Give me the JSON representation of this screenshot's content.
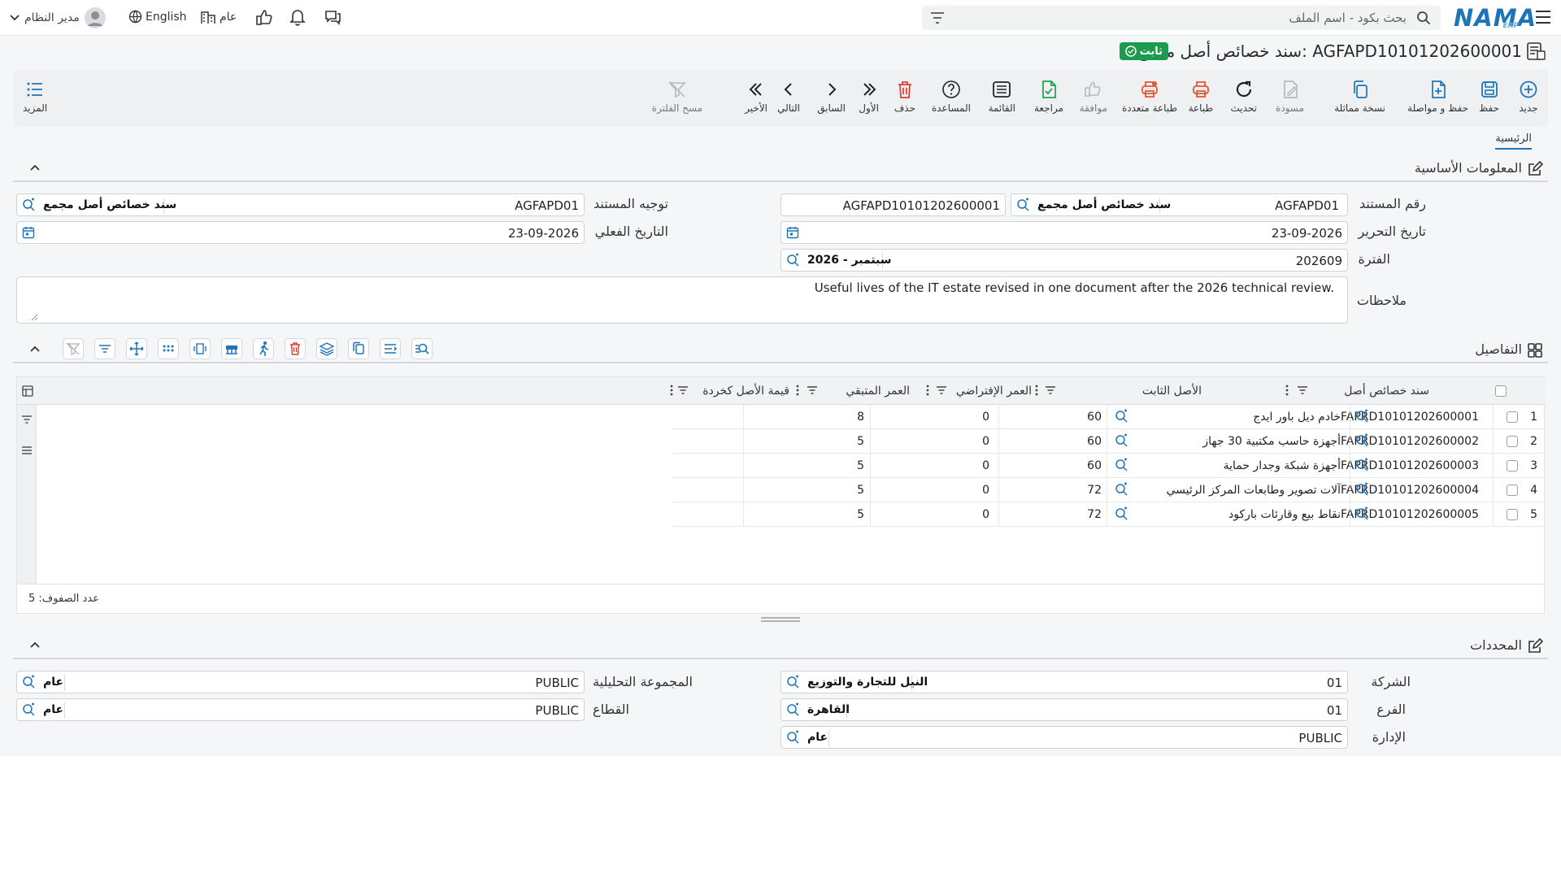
{
  "app": {
    "logo": "NAMA",
    "logo_sub": "ERP"
  },
  "topbar": {
    "search_placeholder": "بحث بكود - اسم الملف",
    "user": "مدير النظام",
    "language": "English",
    "scope": "عام"
  },
  "page": {
    "title": "سند خصائص أصل مجمع: AGFAPD10101202600001",
    "status": "ثابت"
  },
  "toolbar": {
    "new": "جديد",
    "save": "حفظ",
    "save_continue": "حفظ و مواصلة",
    "copy": "نسخة مماثلة",
    "draft": "مسودة",
    "refresh": "تحديث",
    "print": "طباعة",
    "multi_print": "طباعة متعددة",
    "approve": "موافقة",
    "review": "مراجعة",
    "list": "القائمة",
    "help": "المساعدة",
    "delete": "حذف",
    "first": "الأول",
    "previous": "السابق",
    "next": "التالي",
    "last": "الأخير",
    "clear_filter": "مسح الفلترة",
    "more": "المزيد"
  },
  "tabs": {
    "main": "الرئيسية"
  },
  "basic": {
    "section_title": "المعلومات الأساسية",
    "doc_number_label": "رقم المستند",
    "doc_type_code": "AGFAPD01",
    "doc_type_name": "سند خصائص أصل مجمع",
    "doc_number": "AGFAPD10101202600001",
    "direction_label": "توجيه المستند",
    "direction_code": "AGFAPD01",
    "direction_name": "سند خصائص أصل مجمع",
    "edit_date_label": "تاريخ التحرير",
    "edit_date": "23-09-2026",
    "actual_date_label": "التاريخ الفعلي",
    "actual_date": "23-09-2026",
    "period_label": "الفترة",
    "period_code": "202609",
    "period_name": "2026 - سبتمبر",
    "notes_label": "ملاحظات",
    "notes": "Useful lives of the IT estate revised in one document after the 2026 technical review."
  },
  "details": {
    "section_title": "التفاصيل",
    "columns": {
      "doc": "سند خصائص أصل",
      "asset": "الأصل الثابت",
      "default_life": "العمر الإفتراضي",
      "remaining_life": "العمر المتبقي",
      "scrap_value": "قيمة الأصل كخردة"
    },
    "rows": [
      {
        "n": "1",
        "doc": "FAPRD10101202600001",
        "asset": "خادم ديل باور ايدج",
        "default_life": "60",
        "remaining_life": "0",
        "scrap_value": "8"
      },
      {
        "n": "2",
        "doc": "FAPRD10101202600002",
        "asset": "أجهزة حاسب مكتبية 30 جهاز",
        "default_life": "60",
        "remaining_life": "0",
        "scrap_value": "5"
      },
      {
        "n": "3",
        "doc": "FAPRD10101202600003",
        "asset": "أجهزة شبكة وجدار حماية",
        "default_life": "60",
        "remaining_life": "0",
        "scrap_value": "5"
      },
      {
        "n": "4",
        "doc": "FAPRD10101202600004",
        "asset": "آلات تصوير وطابعات المركز الرئيسي",
        "default_life": "72",
        "remaining_life": "0",
        "scrap_value": "5"
      },
      {
        "n": "5",
        "doc": "FAPRD10101202600005",
        "asset": "نقاط بيع وقارئات باركود",
        "default_life": "72",
        "remaining_life": "0",
        "scrap_value": "5"
      }
    ],
    "row_count_label": "عدد الصفوف: 5"
  },
  "dims": {
    "section_title": "المحددات",
    "company_label": "الشركة",
    "company_code": "01",
    "company_name": "النيل للتجارة والتوزيع",
    "branch_label": "الفرع",
    "branch_code": "01",
    "branch_name": "القاهرة",
    "dept_label": "الإدارة",
    "dept_code": "PUBLIC",
    "dept_name": "عام",
    "analytic_label": "المجموعة التحليلية",
    "analytic_code": "PUBLIC",
    "analytic_name": "عام",
    "sector_label": "القطاع",
    "sector_code": "PUBLIC",
    "sector_name": "عام"
  }
}
